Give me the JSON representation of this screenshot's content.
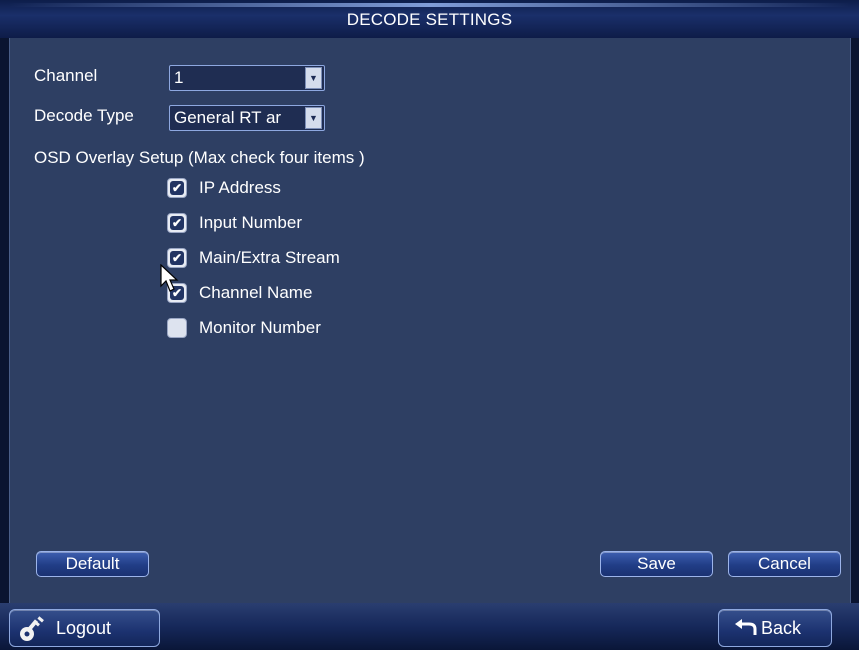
{
  "header": {
    "title": "DECODE SETTINGS"
  },
  "form": {
    "channel_label": "Channel",
    "channel_value": "1",
    "decode_type_label": "Decode Type",
    "decode_type_value": "General RT ar",
    "osd_label": "OSD Overlay Setup (Max check four items )"
  },
  "osd_items": [
    {
      "label": "IP Address",
      "checked": true
    },
    {
      "label": "Input Number",
      "checked": true
    },
    {
      "label": "Main/Extra Stream",
      "checked": true
    },
    {
      "label": "Channel Name",
      "checked": true
    },
    {
      "label": "Monitor Number",
      "checked": false
    }
  ],
  "buttons": {
    "default": "Default",
    "save": "Save",
    "cancel": "Cancel",
    "logout": "Logout",
    "back": "Back"
  },
  "icons": {
    "select_arrow": "chevron-down-icon",
    "logout": "key-icon",
    "back": "back-arrow-icon",
    "check": "checkmark-icon"
  },
  "colors": {
    "panel": "#2e3f63",
    "frame": "#0a1430",
    "button_accent": "#213d86"
  }
}
